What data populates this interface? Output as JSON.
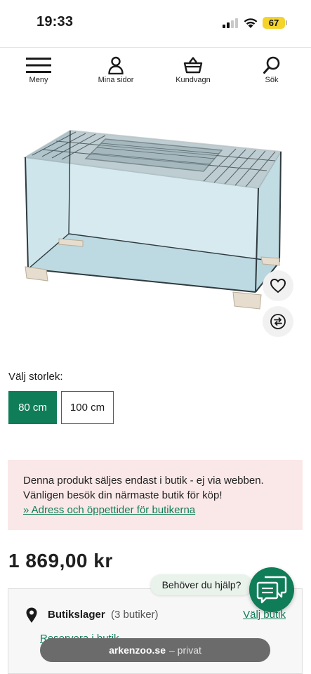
{
  "status_bar": {
    "time": "19:33",
    "battery": "67"
  },
  "nav": [
    {
      "label": "Meny",
      "icon": "menu-icon"
    },
    {
      "label": "Mina sidor",
      "icon": "user-icon"
    },
    {
      "label": "Kundvagn",
      "icon": "basket-icon"
    },
    {
      "label": "Sök",
      "icon": "search-icon"
    }
  ],
  "product": {
    "image_icon": "glass-terrarium-image",
    "actions": {
      "favorite_icon": "heart-icon",
      "compare_icon": "compare-icon"
    }
  },
  "size": {
    "label": "Välj storlek:",
    "options": [
      "80 cm",
      "100 cm"
    ],
    "selected": "80 cm"
  },
  "notice": {
    "line1": "Denna produkt säljes endast i butik - ej via webben.",
    "line2": "Vänligen besök din närmaste butik för köp!",
    "link": "» Adress och öppettider för butikerna"
  },
  "price": "1 869,00 kr",
  "stock": {
    "title": "Butikslager",
    "count": "(3 butiker)",
    "choose_link": "Välj butik",
    "reserve_link": "Reservera i butik"
  },
  "help": {
    "bubble": "Behöver du hjälp?",
    "icon": "chat-icon"
  },
  "url_bar": {
    "domain": "arkenzoo.se",
    "mode": "– privat"
  },
  "colors": {
    "brand_green": "#0f7d57",
    "notice_bg": "#fae8e8",
    "battery": "#f4d32a"
  }
}
